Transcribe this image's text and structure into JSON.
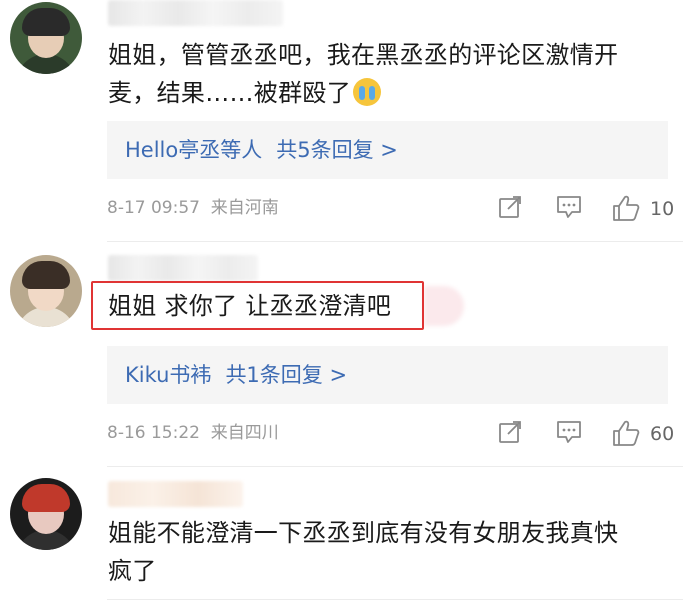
{
  "comments": [
    {
      "text_line1": "姐姐，管管丞丞吧，我在黑丞丞的评论区激情开",
      "text_line2": "麦，结果……被群殴了",
      "emoji": "crying-face",
      "reply_box": {
        "names": "Hello亭丞",
        "suffix": "等人",
        "count": "共5条回复 >"
      },
      "time": "8-17 09:57",
      "source": "来自河南",
      "likes": "10"
    },
    {
      "text_line1": "姐姐 求你了 让丞丞澄清吧",
      "reply_box": {
        "names": "Kiku书袆",
        "suffix": "",
        "count": "共1条回复 >"
      },
      "time": "8-16 15:22",
      "source": "来自四川",
      "likes": "60"
    },
    {
      "text_line1": "姐能不能澄清一下丞丞到底有没有女朋友我真快",
      "text_line2": "疯了"
    }
  ],
  "icons": {
    "share": "share-icon",
    "comment": "comment-icon",
    "like": "thumbs-up-icon"
  },
  "colors": {
    "link": "#3d6bb3",
    "meta": "#9a9a9a",
    "highlight": "#e03434",
    "reply_bg": "#f5f5f5"
  }
}
